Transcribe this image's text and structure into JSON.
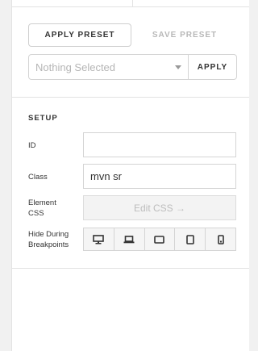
{
  "presets": {
    "apply_preset_label": "APPLY PRESET",
    "save_preset_label": "SAVE PRESET",
    "select_placeholder": "Nothing Selected",
    "apply_label": "APPLY"
  },
  "setup": {
    "section_title": "SETUP",
    "id_label": "ID",
    "id_value": "",
    "class_label": "Class",
    "class_value": "mvn sr",
    "element_css_label_line1": "Element",
    "element_css_label_line2": "CSS",
    "edit_css_label": "Edit CSS →",
    "breakpoints_label_line1": "Hide During",
    "breakpoints_label_line2": "Breakpoints",
    "breakpoints": [
      {
        "icon": "desktop-icon"
      },
      {
        "icon": "laptop-icon"
      },
      {
        "icon": "tablet-landscape-icon"
      },
      {
        "icon": "tablet-portrait-icon"
      },
      {
        "icon": "mobile-icon"
      }
    ]
  },
  "colors": {
    "background": "#f1f1f1",
    "panel": "#ffffff",
    "border": "#d4d4d4",
    "muted_text": "#b8b8b8"
  }
}
